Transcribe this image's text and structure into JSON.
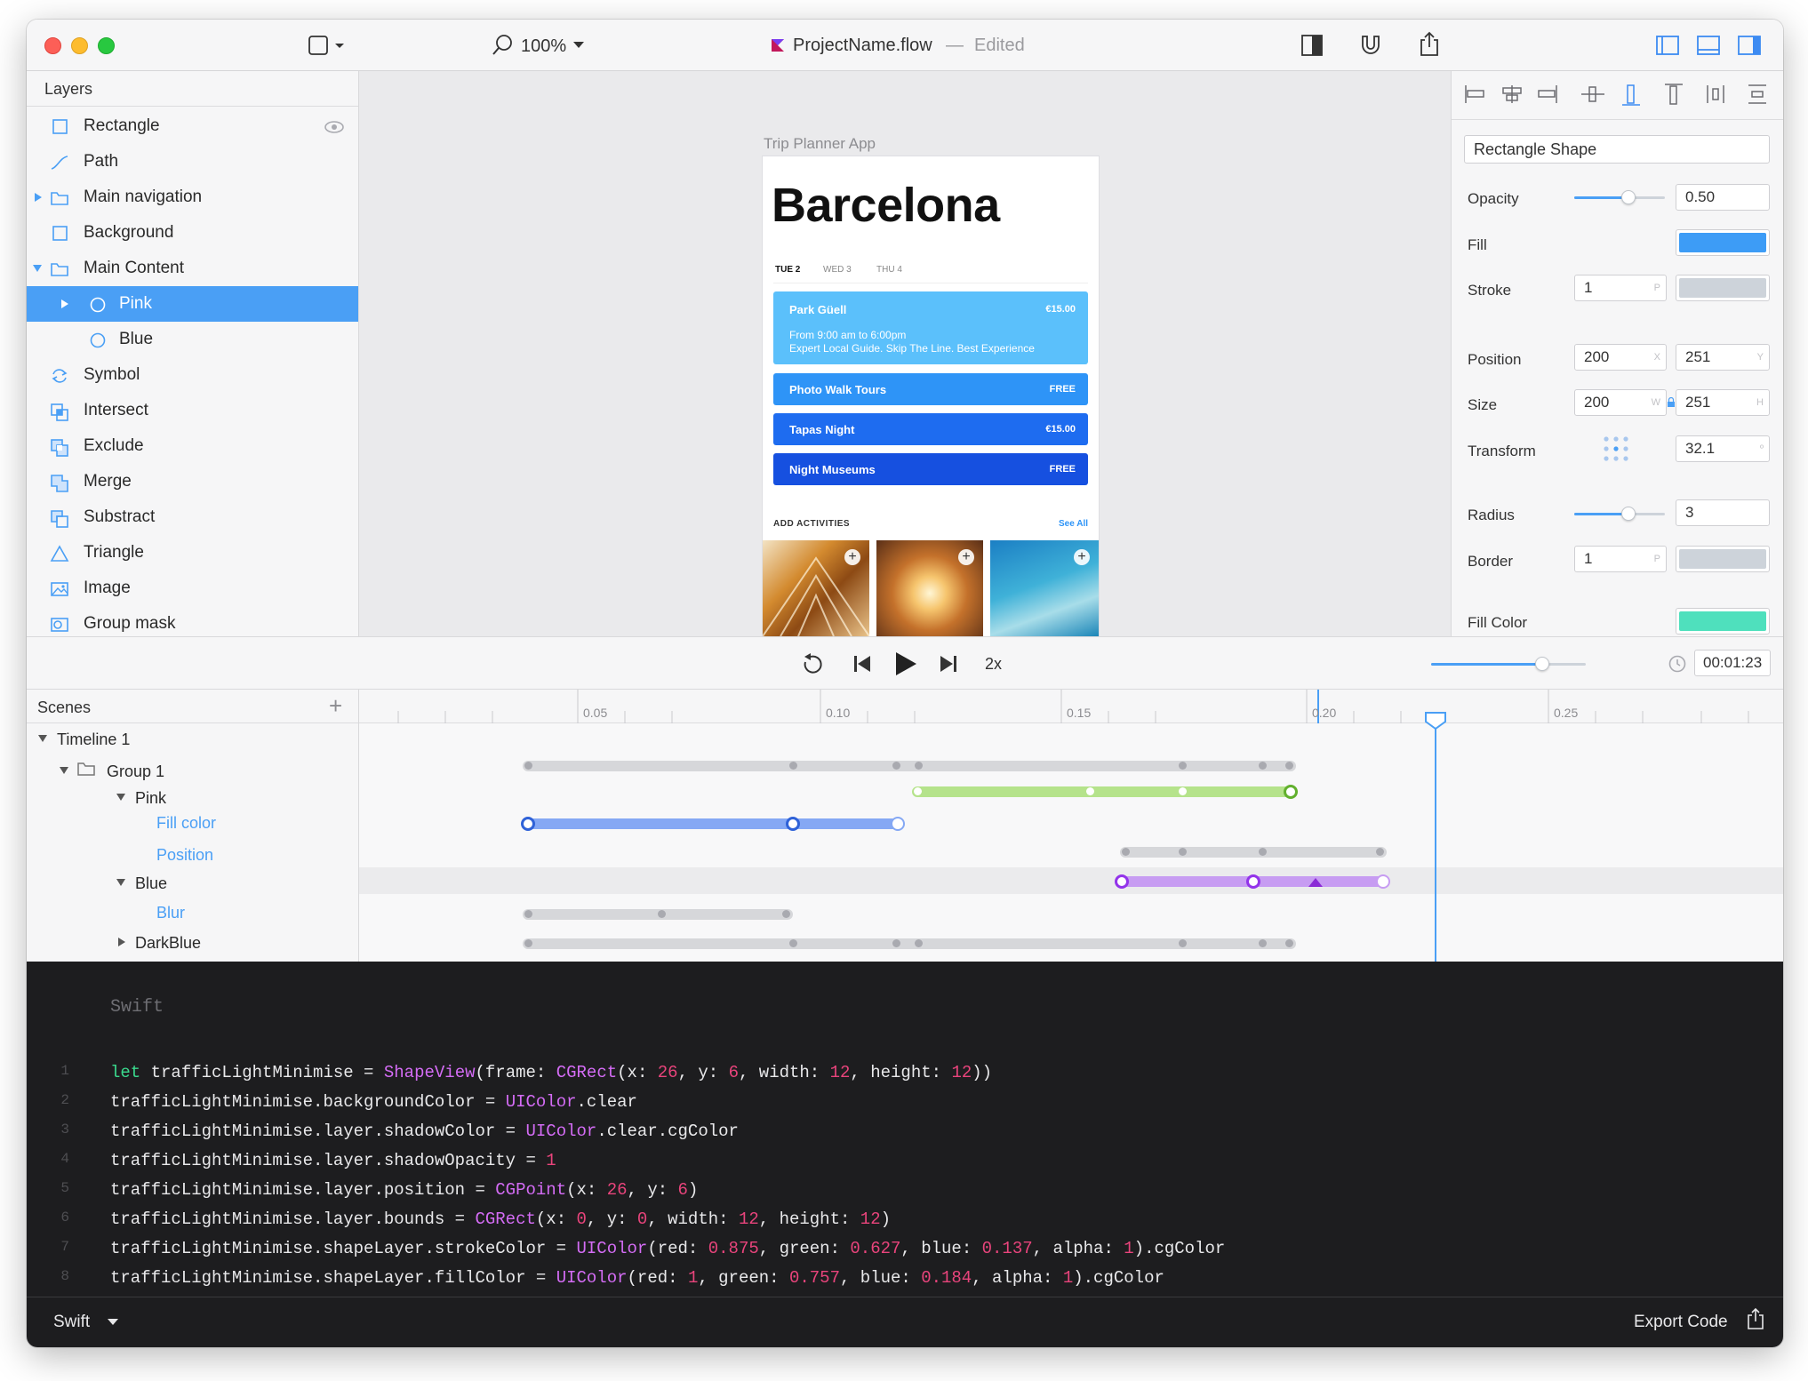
{
  "window": {
    "title": "ProjectName.flow",
    "separator": "—",
    "status": "Edited",
    "zoom": "100%"
  },
  "layers": {
    "header": "Layers",
    "items": [
      {
        "label": "Rectangle",
        "icon": "rectangle-icon"
      },
      {
        "label": "Path",
        "icon": "path-icon"
      },
      {
        "label": "Main navigation",
        "icon": "folder-icon"
      },
      {
        "label": "Background",
        "icon": "rectangle-icon"
      },
      {
        "label": "Main Content",
        "icon": "folder-icon"
      },
      {
        "label": "Pink",
        "icon": "circle-icon"
      },
      {
        "label": "Blue",
        "icon": "circle-icon"
      },
      {
        "label": "Symbol",
        "icon": "symbol-icon"
      },
      {
        "label": "Intersect",
        "icon": "intersect-icon"
      },
      {
        "label": "Exclude",
        "icon": "exclude-icon"
      },
      {
        "label": "Merge",
        "icon": "merge-icon"
      },
      {
        "label": "Substract",
        "icon": "substract-icon"
      },
      {
        "label": "Triangle",
        "icon": "triangle-icon"
      },
      {
        "label": "Image",
        "icon": "image-icon"
      },
      {
        "label": "Group mask",
        "icon": "group-mask-icon"
      }
    ]
  },
  "canvas": {
    "artboard_label": "Trip Planner App",
    "phone": {
      "city": "Barcelona",
      "days": [
        "TUE 2",
        "WED 3",
        "THU 4"
      ],
      "activities": [
        {
          "name": "Park Güell",
          "price": "€15.00",
          "line1": "From 9:00 am to 6:00pm",
          "line2": "Expert Local Guide. Skip The Line. Best Experience",
          "color": "#5bc0fb"
        },
        {
          "name": "Photo Walk Tours",
          "price": "FREE",
          "color": "#2e94f7"
        },
        {
          "name": "Tapas Night",
          "price": "€15.00",
          "color": "#1e6cf0"
        },
        {
          "name": "Night Museums",
          "price": "FREE",
          "color": "#1650e0"
        }
      ],
      "add_activities": "ADD ACTIVITIES",
      "see_all": "See All"
    }
  },
  "properties": {
    "name": "Rectangle Shape",
    "opacity_label": "Opacity",
    "opacity_value": "0.50",
    "opacity_level": 0.6,
    "fill_label": "Fill",
    "fill_color": "#3d9cf6",
    "stroke_label": "Stroke",
    "stroke_value": "1",
    "stroke_suffix": "P",
    "stroke_color": "#cdd3da",
    "position_label": "Position",
    "position_x": "200",
    "position_x_suffix": "X",
    "position_y": "251",
    "position_y_suffix": "Y",
    "size_label": "Size",
    "size_w": "200",
    "size_w_suffix": "W",
    "size_h": "251",
    "size_h_suffix": "H",
    "transform_label": "Transform",
    "transform_value": "32.1",
    "transform_suffix": "º",
    "radius_label": "Radius",
    "radius_value": "3",
    "radius_level": 0.6,
    "border_label": "Border",
    "border_value": "1",
    "border_suffix": "P",
    "border_color": "#cdd3da",
    "fill_color_label": "Fill Color",
    "fill_color_swatch": "#4fe0bd"
  },
  "playback": {
    "speed": "2x",
    "time": "00:01:23",
    "volume_level": 0.72
  },
  "scenes": {
    "header": "Scenes",
    "tree": [
      {
        "label": "Timeline 1",
        "kind": "node"
      },
      {
        "label": "Group 1",
        "kind": "node"
      },
      {
        "label": "Pink",
        "kind": "node"
      },
      {
        "label": "Fill color",
        "kind": "prop"
      },
      {
        "label": "Position",
        "kind": "prop"
      },
      {
        "label": "Blue",
        "kind": "node"
      },
      {
        "label": "Blur",
        "kind": "prop"
      },
      {
        "label": "DarkBlue",
        "kind": "node"
      }
    ]
  },
  "timeline": {
    "ruler": [
      "0.05",
      "0.10",
      "0.15",
      "0.20",
      "0.25"
    ]
  },
  "code": {
    "language": "Swift",
    "lines": [
      [
        [
          "kw",
          "let"
        ],
        [
          "t",
          " trafficLightMinimise = "
        ],
        [
          "ty",
          "ShapeView"
        ],
        [
          "t",
          "(frame: "
        ],
        [
          "ty",
          "CGRect"
        ],
        [
          "t",
          "(x: "
        ],
        [
          "num",
          "26"
        ],
        [
          "t",
          ", y: "
        ],
        [
          "num",
          "6"
        ],
        [
          "t",
          ", width: "
        ],
        [
          "num",
          "12"
        ],
        [
          "t",
          ", height: "
        ],
        [
          "num",
          "12"
        ],
        [
          "t",
          "))"
        ]
      ],
      [
        [
          "t",
          "trafficLightMinimise.backgroundColor = "
        ],
        [
          "ty",
          "UIColor"
        ],
        [
          "t",
          ".clear"
        ]
      ],
      [
        [
          "t",
          "trafficLightMinimise.layer.shadowColor = "
        ],
        [
          "ty",
          "UIColor"
        ],
        [
          "t",
          ".clear.cgColor"
        ]
      ],
      [
        [
          "t",
          "trafficLightMinimise.layer.shadowOpacity = "
        ],
        [
          "num",
          "1"
        ]
      ],
      [
        [
          "t",
          "trafficLightMinimise.layer.position = "
        ],
        [
          "ty",
          "CGPoint"
        ],
        [
          "t",
          "(x: "
        ],
        [
          "num",
          "26"
        ],
        [
          "t",
          ", y: "
        ],
        [
          "num",
          "6"
        ],
        [
          "t",
          ")"
        ]
      ],
      [
        [
          "t",
          "trafficLightMinimise.layer.bounds = "
        ],
        [
          "ty",
          "CGRect"
        ],
        [
          "t",
          "(x: "
        ],
        [
          "num",
          "0"
        ],
        [
          "t",
          ", y: "
        ],
        [
          "num",
          "0"
        ],
        [
          "t",
          ", width: "
        ],
        [
          "num",
          "12"
        ],
        [
          "t",
          ", height: "
        ],
        [
          "num",
          "12"
        ],
        [
          "t",
          ")"
        ]
      ],
      [
        [
          "t",
          "trafficLightMinimise.shapeLayer.strokeColor = "
        ],
        [
          "ty",
          "UIColor"
        ],
        [
          "t",
          "(red: "
        ],
        [
          "num",
          "0.875"
        ],
        [
          "t",
          ", green: "
        ],
        [
          "num",
          "0.627"
        ],
        [
          "t",
          ", blue: "
        ],
        [
          "num",
          "0.137"
        ],
        [
          "t",
          ", alpha: "
        ],
        [
          "num",
          "1"
        ],
        [
          "t",
          ").cgColor"
        ]
      ],
      [
        [
          "t",
          "trafficLightMinimise.shapeLayer.fillColor = "
        ],
        [
          "ty",
          "UIColor"
        ],
        [
          "t",
          "(red: "
        ],
        [
          "num",
          "1"
        ],
        [
          "t",
          ", green: "
        ],
        [
          "num",
          "0.757"
        ],
        [
          "t",
          ", blue: "
        ],
        [
          "num",
          "0.184"
        ],
        [
          "t",
          ", alpha: "
        ],
        [
          "num",
          "1"
        ],
        [
          "t",
          ").cgColor"
        ]
      ]
    ]
  },
  "footer": {
    "language": "Swift",
    "export": "Export Code"
  },
  "colors": {
    "accent": "#4a9ff5",
    "close": "#fc5f57",
    "minimise": "#fdbc2e",
    "zoom": "#28c840"
  }
}
